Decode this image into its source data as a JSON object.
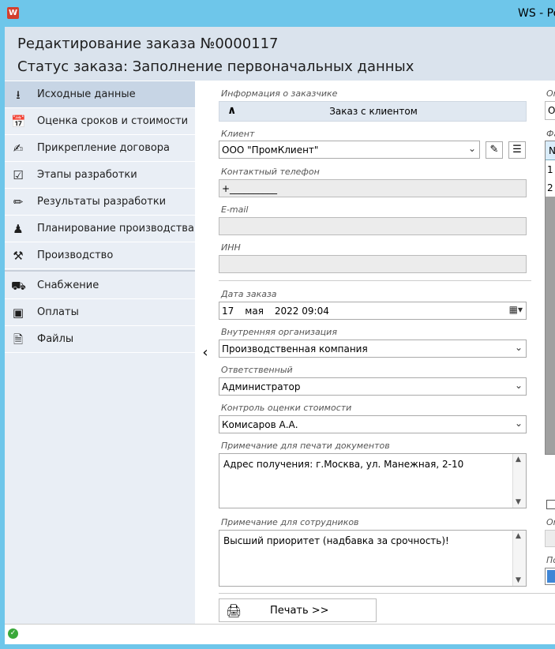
{
  "window": {
    "title": "WS - Pe",
    "app_icon": "W"
  },
  "header": {
    "title": "Редактирование заказа №0000117",
    "status": "Статус заказа: Заполнение первоначальных данных"
  },
  "sidebar": {
    "items": [
      {
        "label": "Исходные данные",
        "icon": "import-icon",
        "active": true
      },
      {
        "label": "Оценка сроков и стоимости",
        "icon": "calendar-cost-icon"
      },
      {
        "label": "Прикрепление договора",
        "icon": "contract-icon"
      },
      {
        "label": "Этапы разработки",
        "icon": "checklist-icon"
      },
      {
        "label": "Результаты разработки",
        "icon": "design-tools-icon"
      },
      {
        "label": "Планирование производства",
        "icon": "worker-icon"
      },
      {
        "label": "Производство",
        "icon": "tools-icon"
      },
      {
        "label": "Снабжение",
        "icon": "truck-icon"
      },
      {
        "label": "Оплаты",
        "icon": "money-icon"
      },
      {
        "label": "Файлы",
        "icon": "document-icon"
      }
    ]
  },
  "form": {
    "customer_info_label": "Информация о заказчике",
    "customer_info_bar": "Заказ с клиентом",
    "client_label": "Клиент",
    "client_value": "ООО \"ПромКлиент\"",
    "phone_label": "Контактный телефон",
    "phone_value": "+__________",
    "email_label": "E-mail",
    "email_value": "",
    "inn_label": "ИНН",
    "inn_value": "",
    "order_date_label": "Дата заказа",
    "order_date_day": "17",
    "order_date_month": "мая",
    "order_date_year_time": "2022 09:04",
    "internal_org_label": "Внутренняя организация",
    "internal_org_value": "Производственная компания",
    "responsible_label": "Ответственный",
    "responsible_value": "Администратор",
    "cost_control_label": "Контроль оценки стоимости",
    "cost_control_value": "Комисаров А.А.",
    "print_note_label": "Примечание для печати документов",
    "print_note_value": "Адрес получения: г.Москва, ул. Манежная, 2-10",
    "staff_note_label": "Примечание для сотрудников",
    "staff_note_value": "Высший приоритет (надбавка за срочность)!",
    "print_button": "Печать >>"
  },
  "right_panel": {
    "label_top": "Or",
    "field_top": "O",
    "label_files": "Фа",
    "table_header": "N",
    "rows": [
      "1",
      "2"
    ],
    "label_bottom1": "Or",
    "label_bottom2": "По"
  },
  "colors": {
    "titlebar": "#6ec6ea",
    "header_bg": "#dae3ed",
    "sidebar_bg": "#e9eef5",
    "active_item": "#c7d5e5",
    "status_ok": "#3aa83a"
  }
}
